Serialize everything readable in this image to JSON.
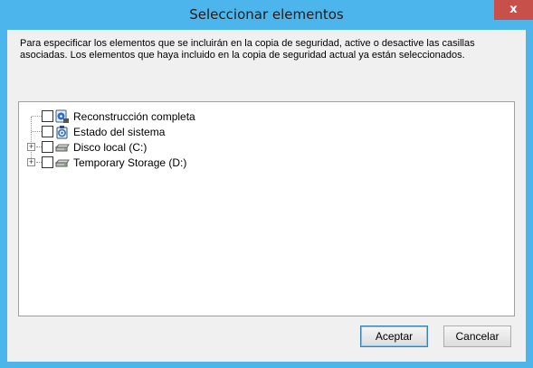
{
  "window": {
    "title": "Seleccionar elementos",
    "close_label": "x"
  },
  "description": "Para especificar los elementos que se incluirán en la copia de seguridad, active o desactive las casillas asociadas. Los elementos que haya incluido en la copia de seguridad actual ya están seleccionados.",
  "tree": {
    "items": [
      {
        "label": "Reconstrucción completa",
        "checked": false,
        "expandable": false,
        "icon": "bare-metal-recovery-icon"
      },
      {
        "label": "Estado del sistema",
        "checked": false,
        "expandable": false,
        "icon": "system-state-icon"
      },
      {
        "label": "Disco local (C:)",
        "checked": false,
        "expandable": true,
        "expander": "+",
        "icon": "hard-drive-icon"
      },
      {
        "label": "Temporary Storage (D:)",
        "checked": false,
        "expandable": true,
        "expander": "+",
        "icon": "hard-drive-icon"
      }
    ]
  },
  "buttons": {
    "ok": "Aceptar",
    "cancel": "Cancelar"
  },
  "colors": {
    "titlebar": "#4cb6ec",
    "close": "#c7504a",
    "client": "#f0f0f0"
  }
}
